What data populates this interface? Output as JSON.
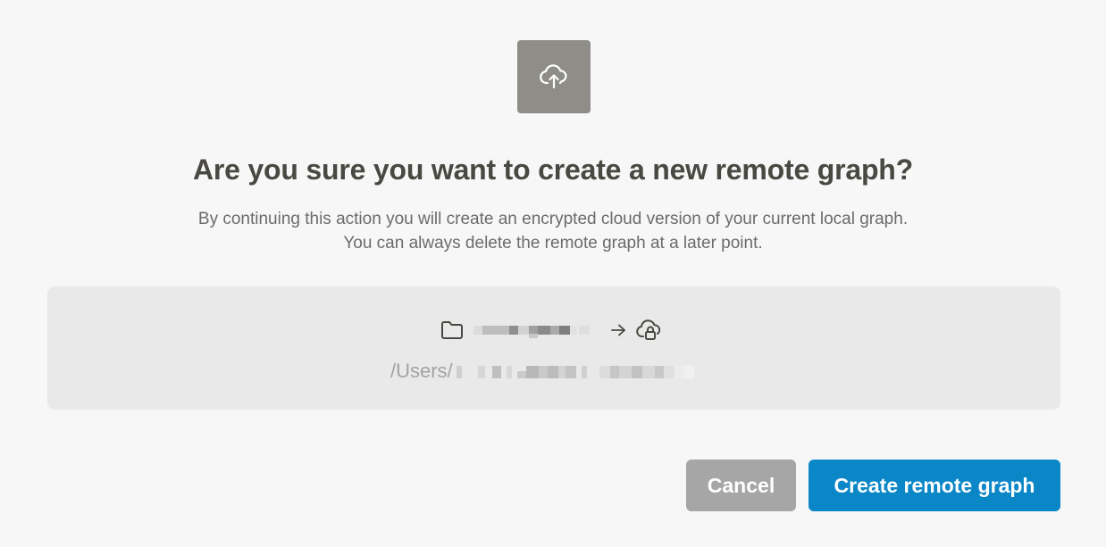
{
  "dialog": {
    "title": "Are you sure you want to create a new remote graph?",
    "description_line1": "By continuing this action you will create an encrypted cloud version of your current local graph.",
    "description_line2": "You can always delete the remote graph at a later point.",
    "icon": "cloud-upload-icon"
  },
  "graph": {
    "source_icon": "folder-icon",
    "arrow_icon": "arrow-right-icon",
    "target_icon": "cloud-lock-icon",
    "path_prefix": "/Users/"
  },
  "actions": {
    "cancel_label": "Cancel",
    "create_label": "Create remote graph"
  },
  "colors": {
    "primary": "#0b87c8",
    "secondary": "#a6a6a6",
    "icon_tile": "#8e8d88",
    "background": "#f7f7f7"
  }
}
